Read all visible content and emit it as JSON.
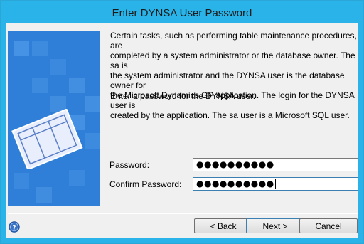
{
  "window": {
    "title": "Enter DYNSA User Password"
  },
  "description": {
    "lines": [
      "Certain tasks, such as performing table maintenance procedures, are",
      "completed by a system administrator or the database owner.  The sa is",
      "the system administrator and the DYNSA user is the database owner for",
      "the Microsoft Dynamics GP application.  The login for the DYNSA user is",
      "created by the application.  The sa user is a Microsoft SQL user."
    ]
  },
  "prompt": "Enter a password for the DYNSA user.",
  "fields": {
    "password": {
      "label": "Password:",
      "value": "●●●●●●●●●●"
    },
    "confirm": {
      "label": "Confirm Password:",
      "value": "●●●●●●●●●●"
    }
  },
  "buttons": {
    "back": {
      "label_prefix": "< ",
      "label_accel": "B",
      "label_rest": "ack"
    },
    "next": "Next >",
    "cancel": "Cancel"
  },
  "icons": {
    "help": "help-icon",
    "panel": "document-illustration"
  },
  "colors": {
    "titlebar": "#2ab3e8",
    "panel": "#2f7fd8"
  }
}
